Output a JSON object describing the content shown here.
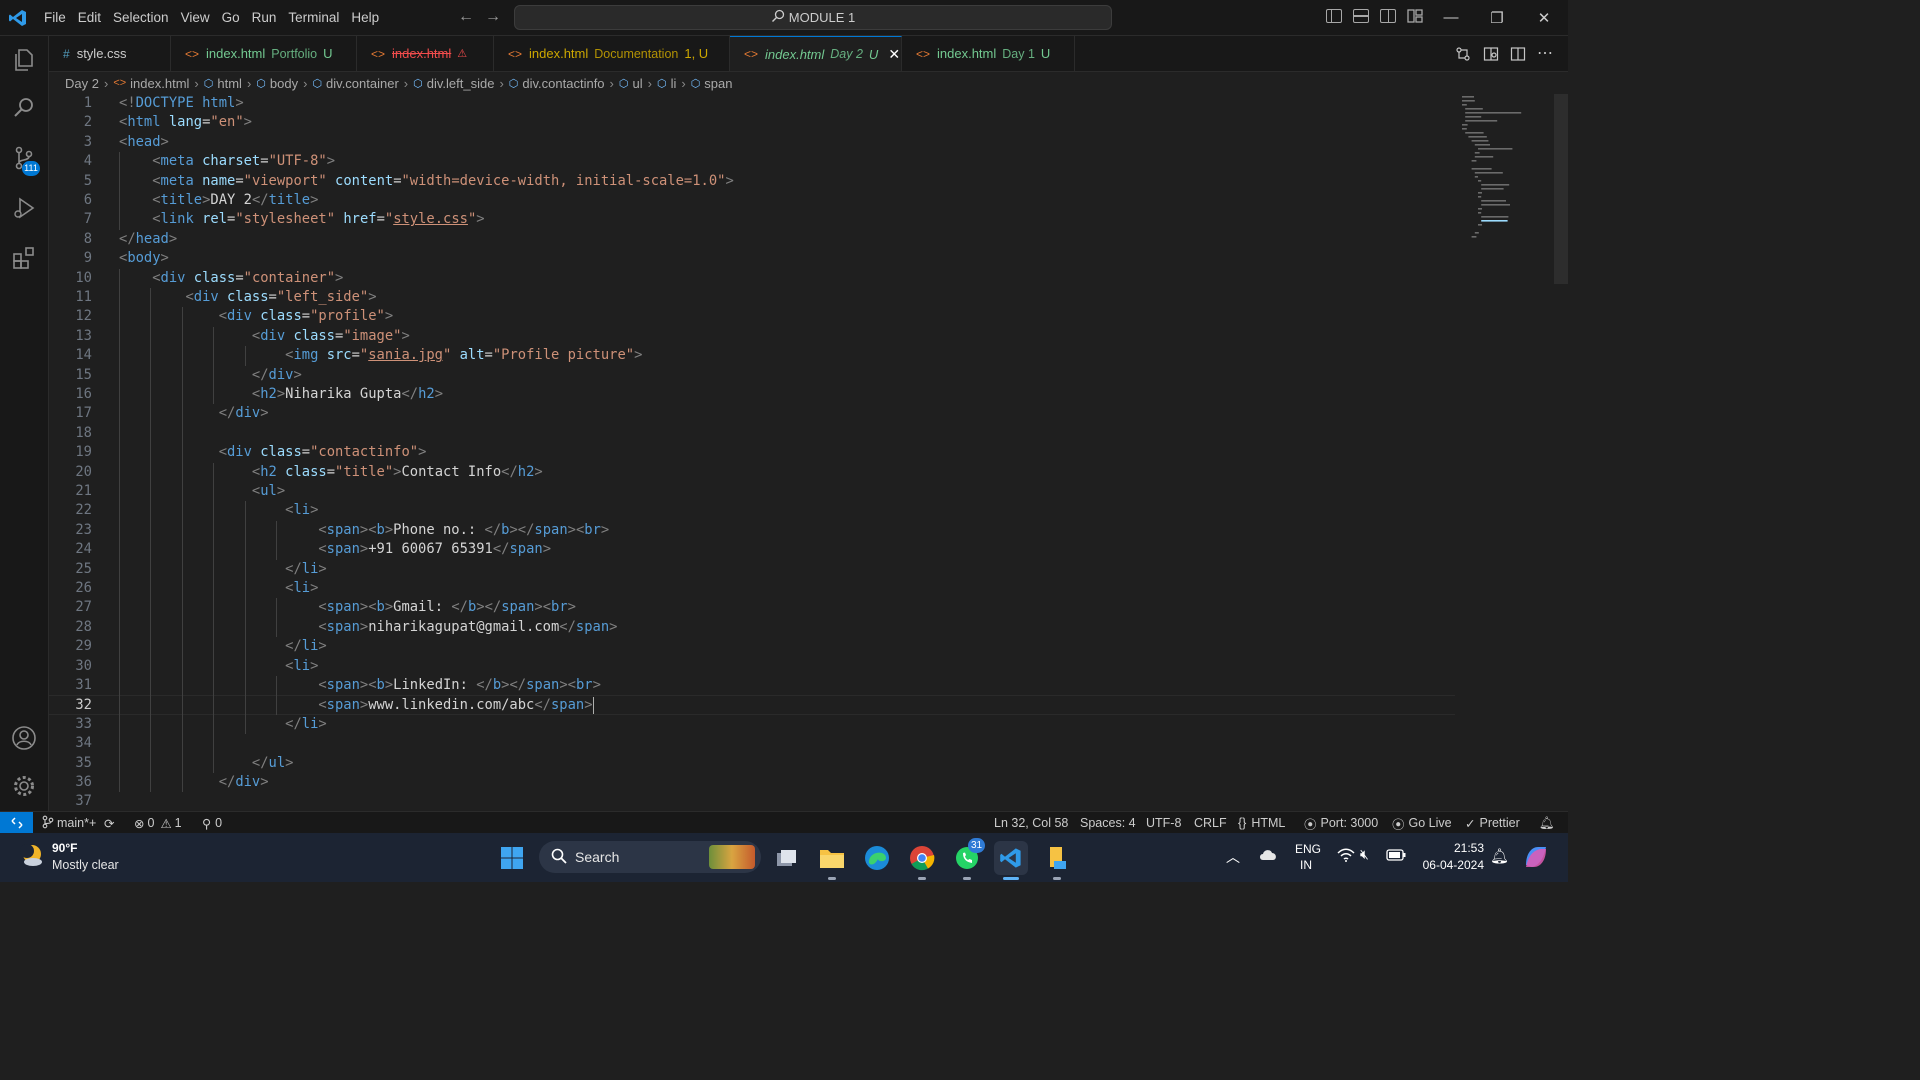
{
  "menu": [
    "File",
    "Edit",
    "Selection",
    "View",
    "Go",
    "Run",
    "Terminal",
    "Help"
  ],
  "command_center": "MODULE 1",
  "source_control_badge": "111",
  "tabs": [
    {
      "icon": "#",
      "name": "style.css",
      "desc": "",
      "badge": "",
      "color": "#cccccc"
    },
    {
      "icon": "<>",
      "name": "index.html",
      "desc": "Portfolio",
      "badge": "U",
      "color": "#73c991"
    },
    {
      "icon": "<>",
      "name": "index.html",
      "desc": "",
      "badge": "⚠",
      "color": "#f14c4c"
    },
    {
      "icon": "<>",
      "name": "index.html",
      "desc": "Documentation",
      "badge": "1, U",
      "color": "#cca700"
    },
    {
      "icon": "<>",
      "name": "index.html",
      "desc": "Day 2",
      "badge": "U",
      "color": "#73c991",
      "close": "✕"
    },
    {
      "icon": "<>",
      "name": "index.html",
      "desc": "Day 1",
      "badge": "U",
      "color": "#73c991"
    }
  ],
  "breadcrumb": [
    "Day 2",
    "index.html",
    "html",
    "body",
    "div.container",
    "div.left_side",
    "div.contactinfo",
    "ul",
    "li",
    "span"
  ],
  "editor": {
    "current_line": 32,
    "lines": [
      "<!DOCTYPE html>",
      "<html lang=\"en\">",
      "<head>",
      "    <meta charset=\"UTF-8\">",
      "    <meta name=\"viewport\" content=\"width=device-width, initial-scale=1.0\">",
      "    <title>DAY 2</title>",
      "    <link rel=\"stylesheet\" href=\"style.css\">",
      "</head>",
      "<body>",
      "    <div class=\"container\">",
      "        <div class=\"left_side\">",
      "            <div class=\"profile\">",
      "                <div class=\"image\">",
      "                    <img src=\"sania.jpg\" alt=\"Profile picture\">",
      "                </div>",
      "                <h2>Niharika Gupta</h2>",
      "            </div>",
      "",
      "            <div class=\"contactinfo\">",
      "                <h2 class=\"title\">Contact Info</h2>",
      "                <ul>",
      "                    <li>",
      "                        <span><b>Phone no.: </b></span><br>",
      "                        <span>+91 60067 65391</span>",
      "                    </li>",
      "                    <li>",
      "                        <span><b>Gmail: </b></span><br>",
      "                        <span>niharikagupat@gmail.com</span>",
      "                    </li>",
      "                    <li>",
      "                        <span><b>LinkedIn: </b></span><br>",
      "                        <span>www.linkedin.com/abc</span>",
      "                    </li>",
      "",
      "                </ul>",
      "            </div>",
      ""
    ]
  },
  "status": {
    "branch": "main*+",
    "errors": "0",
    "warnings": "1",
    "ports": "0",
    "position": "Ln 32, Col 58",
    "spaces": "Spaces: 4",
    "encoding": "UTF-8",
    "eol": "CRLF",
    "language": "HTML",
    "port": "Port: 3000",
    "golive": "Go Live",
    "prettier": "Prettier"
  },
  "taskbar": {
    "weather_temp": "90°F",
    "weather_desc": "Mostly clear",
    "search_label": "Search",
    "whatsapp_badge": "31",
    "lang": "ENG",
    "region": "IN",
    "time": "21:53",
    "date": "06-04-2024"
  }
}
